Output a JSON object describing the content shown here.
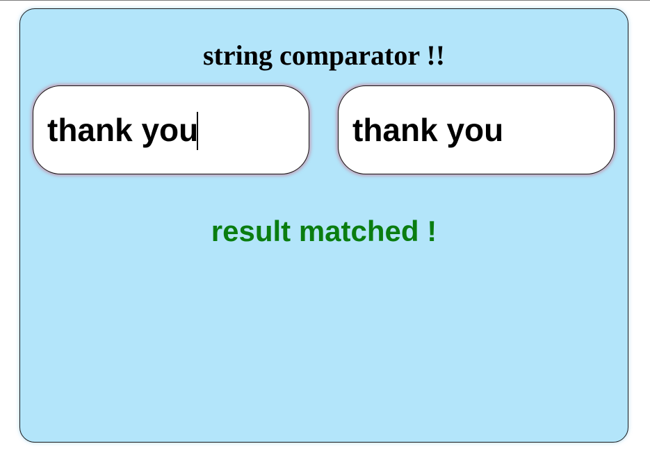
{
  "app": {
    "title": "string comparator !!"
  },
  "inputs": {
    "first": {
      "value": "thank you",
      "focused": true
    },
    "second": {
      "value": "thank you",
      "focused": false
    }
  },
  "result": {
    "text": "result matched !",
    "color": "#0a7d10"
  },
  "colors": {
    "panel_background": "#b3e5fa",
    "field_glow": "#cd5f78"
  }
}
